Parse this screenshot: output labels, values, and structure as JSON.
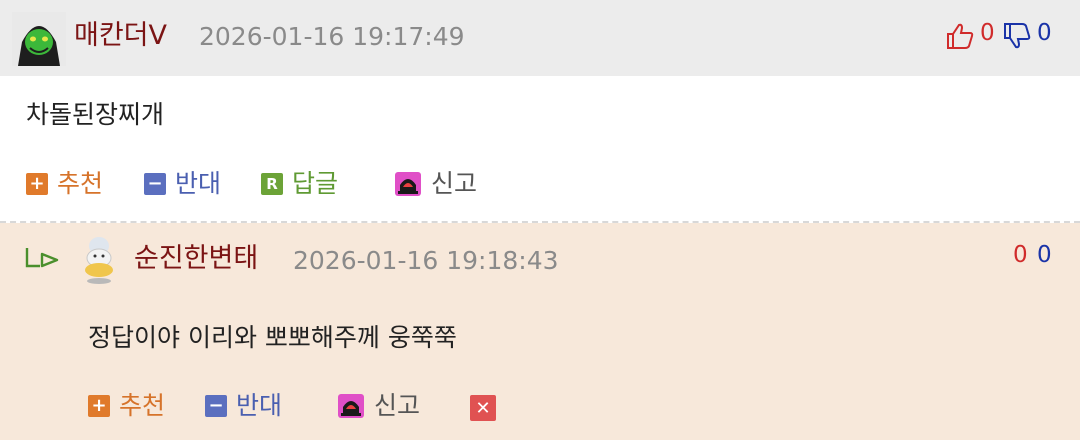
{
  "comment1": {
    "nickname": "매칸더V",
    "datetime": "2026-01-16 19:17:49",
    "upvotes": "0",
    "downvotes": "0",
    "body": "차돌된장찌개",
    "actions": {
      "recommend": "추천",
      "oppose": "반대",
      "reply": "답글",
      "report": "신고"
    },
    "icons": {
      "recommend": "plus-icon",
      "oppose": "minus-icon",
      "reply": "r-icon",
      "report": "siren-icon",
      "up": "thumbs-up-icon",
      "down": "thumbs-down-icon"
    }
  },
  "comment2": {
    "nickname": "순진한변태",
    "datetime": "2026-01-16 19:18:43",
    "upvotes": "0",
    "downvotes": "0",
    "body": "정답이야 이리와 뽀뽀해주께 웅쭉쭉",
    "actions": {
      "recommend": "추천",
      "oppose": "반대",
      "report": "신고"
    },
    "icons": {
      "reply_indicator": "reply-arrow-icon",
      "delete": "close-icon"
    }
  },
  "colors": {
    "header_bg": "#ececec",
    "reply_bg": "#f7e8da",
    "nickname": "#7b1414",
    "upvote": "#d02b2b",
    "downvote": "#1a33a8"
  }
}
